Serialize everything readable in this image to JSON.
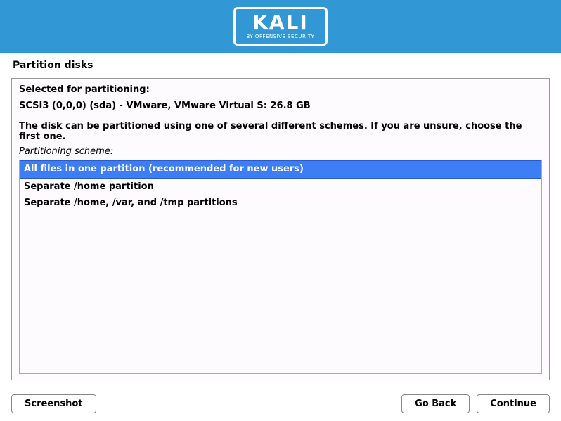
{
  "logo": {
    "main": "KALI",
    "sub": "BY OFFENSIVE SECURITY"
  },
  "page_title": "Partition disks",
  "main": {
    "selected_label": "Selected for partitioning:",
    "disk": "SCSI3 (0,0,0) (sda) - VMware, VMware Virtual S: 26.8 GB",
    "instruction": "The disk can be partitioned using one of several different schemes. If you are unsure, choose the first one.",
    "scheme_label": "Partitioning scheme:",
    "options": [
      "All files in one partition (recommended for new users)",
      "Separate /home partition",
      "Separate /home, /var, and /tmp partitions"
    ],
    "selected_index": 0
  },
  "buttons": {
    "screenshot": "Screenshot",
    "go_back": "Go Back",
    "continue": "Continue"
  }
}
